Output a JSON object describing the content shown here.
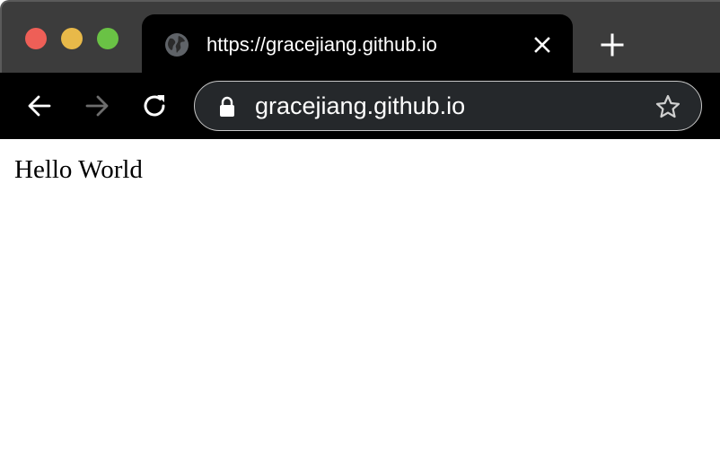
{
  "window": {
    "controls": [
      {
        "name": "close",
        "color": "#ee5f57"
      },
      {
        "name": "minimize",
        "color": "#e8b949"
      },
      {
        "name": "zoom",
        "color": "#6ac245"
      }
    ]
  },
  "tab": {
    "title": "https://gracejiang.github.io",
    "favicon": "globe-icon",
    "close_icon": "close-icon"
  },
  "new_tab_icon": "plus-icon",
  "toolbar": {
    "back_icon": "arrow-left-icon",
    "forward_icon": "arrow-right-icon",
    "reload_icon": "reload-icon"
  },
  "omnibox": {
    "url": "gracejiang.github.io",
    "lock_icon": "lock-icon",
    "bookmark_icon": "star-icon"
  },
  "page": {
    "text": "Hello World"
  },
  "colors": {
    "tabstrip": "#3c3c3c",
    "toolbar": "#000000",
    "omnibox_bg": "#25282b",
    "omnibox_border": "#c7c7c7",
    "page_bg": "#ffffff"
  }
}
